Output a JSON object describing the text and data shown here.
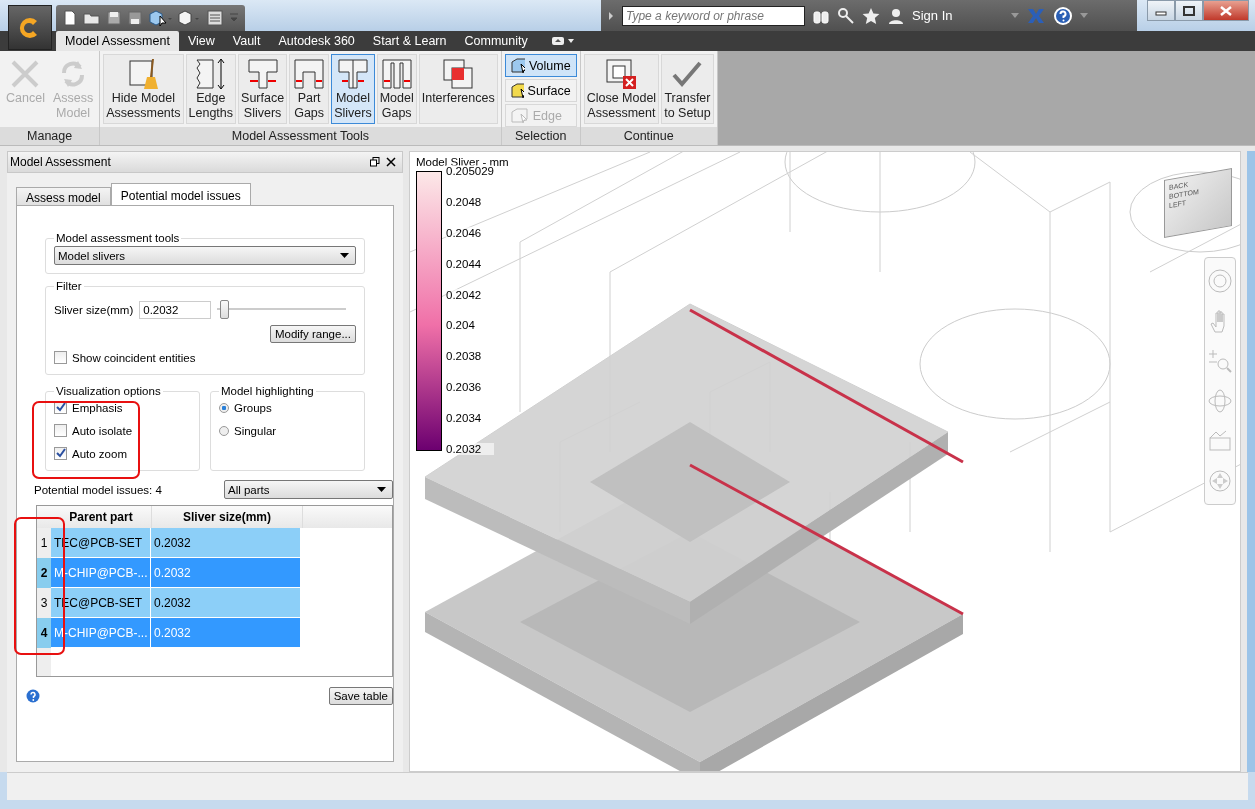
{
  "title_bar": {
    "search": {
      "placeholder": "Type a keyword or phrase"
    },
    "sign_in": "Sign In"
  },
  "ribbon_tabs": [
    {
      "label": "Model Assessment",
      "selected": true
    },
    {
      "label": "View",
      "selected": false
    },
    {
      "label": "Vault",
      "selected": false
    },
    {
      "label": "Autodesk 360",
      "selected": false
    },
    {
      "label": "Start & Learn",
      "selected": false
    },
    {
      "label": "Community",
      "selected": false
    }
  ],
  "ribbon_panels": [
    {
      "title": "Manage",
      "buttons": [
        {
          "kind": "cross",
          "lines": [
            "Cancel"
          ],
          "selected": false,
          "disabled": true
        },
        {
          "kind": "refresh",
          "lines": [
            "Assess",
            "Model"
          ],
          "selected": false,
          "disabled": true
        }
      ]
    },
    {
      "title": "Model Assessment Tools",
      "buttons": [
        {
          "kind": "broom",
          "lines": [
            "Hide Model",
            "Assessments"
          ],
          "selected": false,
          "disabled": false
        },
        {
          "kind": "edge",
          "lines": [
            "Edge",
            "Lengths"
          ],
          "selected": false,
          "disabled": false
        },
        {
          "kind": "surface",
          "lines": [
            "Surface",
            "Slivers"
          ],
          "selected": false,
          "disabled": false
        },
        {
          "kind": "gap",
          "lines": [
            "Part",
            "Gaps"
          ],
          "selected": false,
          "disabled": false
        },
        {
          "kind": "sliver",
          "lines": [
            "Model",
            "Slivers"
          ],
          "selected": true,
          "disabled": false
        },
        {
          "kind": "modelgap",
          "lines": [
            "Model",
            "Gaps"
          ],
          "selected": false,
          "disabled": false
        },
        {
          "kind": "overlap",
          "lines": [
            "Interferences"
          ],
          "selected": false,
          "disabled": false
        }
      ]
    },
    {
      "title": "Selection",
      "small_buttons": [
        {
          "kind": "volume",
          "label": "Volume",
          "selected": true,
          "disabled": false
        },
        {
          "kind": "surface",
          "label": "Surface",
          "selected": false,
          "disabled": false
        },
        {
          "kind": "edge",
          "label": "Edge",
          "selected": false,
          "disabled": true
        }
      ]
    },
    {
      "title": "Continue",
      "buttons": [
        {
          "kind": "close",
          "lines": [
            "Close Model",
            "Assessment"
          ],
          "selected": false,
          "disabled": false
        },
        {
          "kind": "check",
          "lines": [
            "Transfer",
            "to Setup"
          ],
          "selected": false,
          "disabled": false
        }
      ]
    }
  ],
  "panel": {
    "title": "Model Assessment",
    "tabs": [
      {
        "label": "Assess model",
        "selected": false
      },
      {
        "label": "Potential model issues",
        "selected": true
      }
    ],
    "tools_group": {
      "title": "Model assessment tools",
      "dropdown": "Model slivers"
    },
    "filter": {
      "title": "Filter",
      "label": "Sliver size(mm)",
      "value": "0.2032",
      "level": 0.02,
      "button": "Modify range...",
      "checkbox": {
        "label": "Show coincident entities",
        "checked": false
      }
    },
    "visualization": {
      "title": "Visualization options",
      "options": [
        {
          "label": "Emphasis",
          "checked": true
        },
        {
          "label": "Auto isolate",
          "checked": false
        },
        {
          "label": "Auto zoom",
          "checked": true
        }
      ]
    },
    "highlighting": {
      "title": "Model highlighting",
      "options": [
        {
          "label": "Groups",
          "selected": true
        },
        {
          "label": "Singular",
          "selected": false
        }
      ]
    },
    "issues_label": "Potential model issues: 4",
    "parts_dropdown": "All parts",
    "table": {
      "columns": [
        "Parent part",
        "Sliver size(mm)"
      ],
      "rows": [
        {
          "index": "1",
          "part": "TEC@PCB-SET",
          "size": "0.2032",
          "selected": false
        },
        {
          "index": "2",
          "part": "M-CHIP@PCB-...",
          "size": "0.2032",
          "selected": true
        },
        {
          "index": "3",
          "part": "TEC@PCB-SET",
          "size": "0.2032",
          "selected": false
        },
        {
          "index": "4",
          "part": "M-CHIP@PCB-...",
          "size": "0.2032",
          "selected": true
        }
      ]
    },
    "save_button": "Save table"
  },
  "viewport": {
    "legend": {
      "title": "Model Sliver - mm",
      "ticks": [
        "0.205029",
        "0.2048",
        "0.2046",
        "0.2044",
        "0.2042",
        "0.204",
        "0.2038",
        "0.2036",
        "0.2034",
        "0.2032"
      ]
    },
    "view_cube": [
      "BACK",
      "BOTTOM",
      "LEFT"
    ]
  }
}
